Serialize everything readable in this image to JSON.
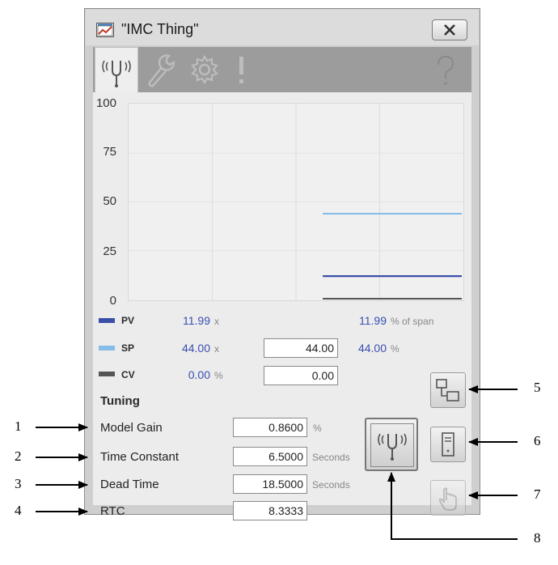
{
  "window": {
    "title": "\"IMC Thing\""
  },
  "tabs": [
    {
      "name": "operator",
      "icon": "tuning-fork-icon"
    },
    {
      "name": "engineering",
      "icon": "wrench-icon"
    },
    {
      "name": "configuration",
      "icon": "gear-icon"
    },
    {
      "name": "alarms",
      "icon": "exclamation-icon"
    },
    {
      "name": "help",
      "icon": "question-icon"
    }
  ],
  "chart_data": {
    "type": "line",
    "y_ticks": [
      "100",
      "75",
      "50",
      "25",
      "0"
    ],
    "ylim": [
      0,
      100
    ],
    "grid": true,
    "series": [
      {
        "name": "PV",
        "color": "#3b4fa8",
        "value": 11.99,
        "x_start_fraction": 0.58
      },
      {
        "name": "SP",
        "color": "#86bde8",
        "value": 44.0,
        "x_start_fraction": 0.58
      },
      {
        "name": "CV",
        "color": "#555555",
        "value": 0.0,
        "x_start_fraction": 0.58
      }
    ]
  },
  "legend": {
    "pv": {
      "label": "PV",
      "value": "11.99",
      "unit": "x",
      "span_value": "11.99",
      "span_unit": "% of span"
    },
    "sp": {
      "label": "SP",
      "value": "44.00",
      "unit": "x",
      "entry": "44.00",
      "pct_value": "44.00",
      "pct_unit": "%"
    },
    "cv": {
      "label": "CV",
      "value": "0.00",
      "unit": "%",
      "entry": "0.00"
    }
  },
  "tuning": {
    "header": "Tuning",
    "rows": [
      {
        "label": "Model Gain",
        "value": "0.8600",
        "unit": "%"
      },
      {
        "label": "Time Constant",
        "value": "6.5000",
        "unit": "Seconds"
      },
      {
        "label": "Dead Time",
        "value": "18.5000",
        "unit": "Seconds"
      },
      {
        "label": "RTC",
        "value": "8.3333",
        "unit": ""
      }
    ]
  },
  "callouts": [
    "1",
    "2",
    "3",
    "4",
    "5",
    "6",
    "7",
    "8"
  ]
}
